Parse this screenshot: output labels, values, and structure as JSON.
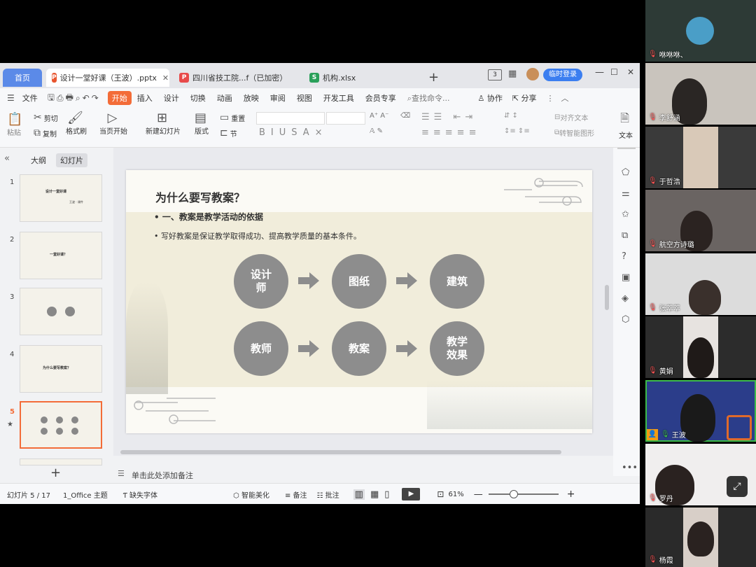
{
  "tabs": {
    "home": "首页",
    "tab1": "设计一堂好课（王波）.pptx",
    "tab2": "四川省技工院...f（已加密）",
    "tab3": "机构.xlsx",
    "login": "临时登录",
    "badge": "3"
  },
  "menu": {
    "file": "文件",
    "items": [
      "开始",
      "插入",
      "设计",
      "切换",
      "动画",
      "放映",
      "审阅",
      "视图",
      "开发工具",
      "会员专享"
    ],
    "search": "查找命令...",
    "collab": "协作",
    "share": "分享"
  },
  "toolbar": {
    "paste": "粘贴",
    "cut": "剪切",
    "copy": "复制",
    "format": "格式刷",
    "from_current": "当页开始",
    "new_slide": "新建幻灯片",
    "layout": "版式",
    "section": "节",
    "reset": "重置",
    "align_text": "对齐文本",
    "smart_shape": "转智能图形",
    "text": "文本"
  },
  "leftpane": {
    "outline_tab": "大纲",
    "slides_tab": "幻灯片",
    "slides": [
      {
        "num": "1",
        "title": "设计一堂好课",
        "sub": "王波 · 课件"
      },
      {
        "num": "2",
        "title": "一堂好课？"
      },
      {
        "num": "3",
        "title": ""
      },
      {
        "num": "4",
        "title": "为什么要写教案？"
      },
      {
        "num": "5",
        "title": ""
      }
    ]
  },
  "slide": {
    "title": "为什么要写教案？",
    "bullet1": "一、教案是教学活动的依据",
    "bullet2": "写好教案是保证教学取得成功、提高教学质量的基本条件。",
    "row1": [
      "设计师",
      "图纸",
      "建筑"
    ],
    "row2": [
      "教师",
      "教案",
      "教学效果"
    ]
  },
  "notes": {
    "placeholder": "单击此处添加备注"
  },
  "status": {
    "slide_pos": "幻灯片 5 / 17",
    "theme": "1_Office 主题",
    "missing_font": "缺失字体",
    "beautify": "智能美化",
    "notes": "备注",
    "comments": "批注",
    "zoom": "61%"
  },
  "participants": [
    {
      "name": "咻咻咻、",
      "bg": "#2d3a36"
    },
    {
      "name": "李舒涵",
      "bg": "#c9c4bd"
    },
    {
      "name": "于哲浩",
      "bg": "#3a3a3a"
    },
    {
      "name": "航空方诗璐",
      "bg": "#6a6462"
    },
    {
      "name": "张萃萃",
      "bg": "#dcdcdc"
    },
    {
      "name": "黄娟",
      "bg": "#2c2c2c"
    },
    {
      "name": "王波",
      "bg": "#2b3d8a"
    },
    {
      "name": "罗丹",
      "bg": "#f0eeee"
    },
    {
      "name": "杨霞",
      "bg": "#2a2a2a"
    }
  ],
  "colors": {
    "accent": "#f36c38",
    "home_tab": "#5b8ae8",
    "login": "#3b7ef0",
    "circle": "#8d8d8d",
    "active_speaker": "#3dbb4a"
  }
}
